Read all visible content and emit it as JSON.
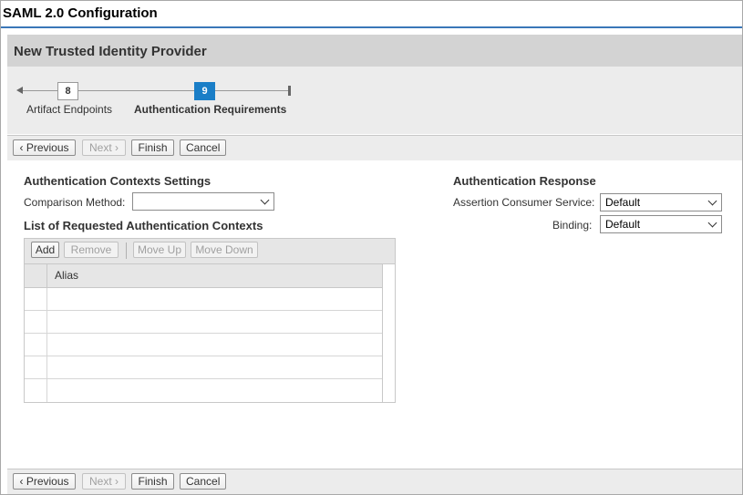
{
  "app": {
    "title": "SAML 2.0 Configuration"
  },
  "wizard": {
    "title": "New Trusted Identity Provider",
    "steps": [
      {
        "number": "8",
        "label": "Artifact Endpoints",
        "state": "done"
      },
      {
        "number": "9",
        "label": "Authentication Requirements",
        "state": "current"
      }
    ]
  },
  "toolbar": {
    "previous_label": "Previous",
    "next_label": "Next",
    "finish_label": "Finish",
    "cancel_label": "Cancel"
  },
  "auth_contexts": {
    "heading": "Authentication Contexts Settings",
    "comparison_label": "Comparison Method:",
    "comparison_value": ""
  },
  "requested_contexts": {
    "heading": "List of Requested Authentication Contexts",
    "buttons": {
      "add": "Add",
      "remove": "Remove",
      "move_up": "Move Up",
      "move_down": "Move Down"
    },
    "columns": [
      "Alias"
    ],
    "rows": [
      "",
      "",
      "",
      "",
      ""
    ]
  },
  "auth_response": {
    "heading": "Authentication Response",
    "acs_label": "Assertion Consumer Service:",
    "acs_value": "Default",
    "binding_label": "Binding:",
    "binding_value": "Default"
  },
  "colors": {
    "accent": "#1a7ec7",
    "title_rule": "#3a77b8",
    "header_bg": "#d3d3d3",
    "panel_bg": "#ececec"
  },
  "icons": {
    "previous": "chevron-left-icon",
    "next": "chevron-right-icon",
    "dropdown": "chevron-down-icon"
  }
}
